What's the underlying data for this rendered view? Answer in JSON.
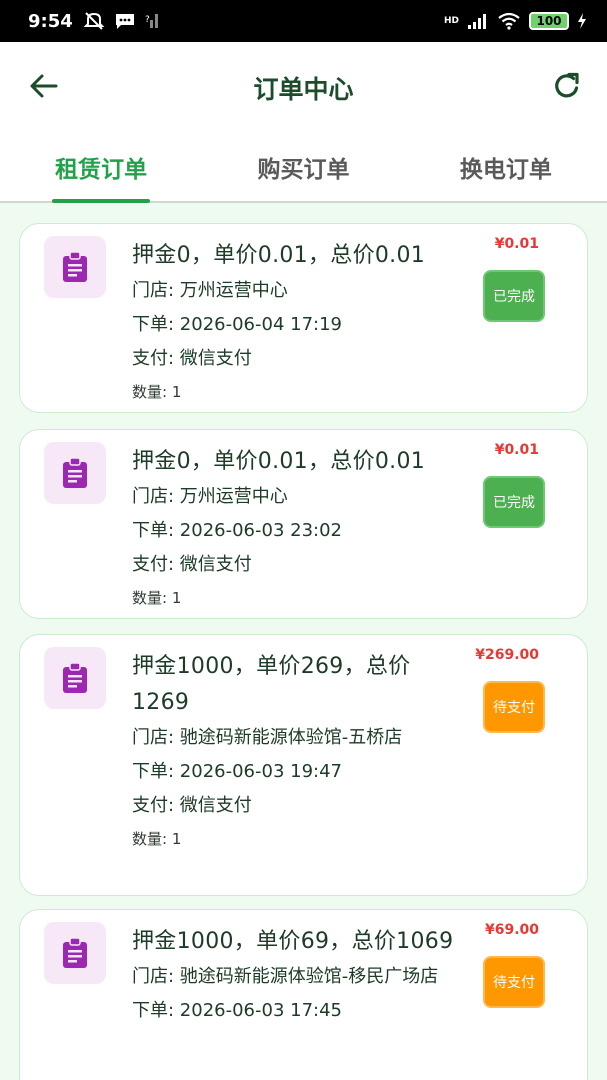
{
  "status_bar": {
    "time": "9:54",
    "icons": [
      "mute-icon",
      "message-icon",
      "no-sim-icon"
    ],
    "network": "HD",
    "battery": "100"
  },
  "header": {
    "title": "订单中心",
    "back_icon": "arrow-left-icon",
    "refresh_icon": "refresh-icon"
  },
  "tabs": [
    {
      "label": "租赁订单",
      "active": true
    },
    {
      "label": "购买订单",
      "active": false
    },
    {
      "label": "换电订单",
      "active": false
    }
  ],
  "colors": {
    "primary_green": "#22a04a",
    "price_red": "#e53935",
    "done_green": "#4caf50",
    "pending_orange": "#ff9800",
    "background": "#effbf0",
    "icon_purple": "#9c27b0"
  },
  "orders": [
    {
      "title": "押金0，单价0.01，总价0.01",
      "store": "门店: 万州运营中心",
      "placed": "下单: 2026-06-04 17:19",
      "payment": "支付: 微信支付",
      "qty": "数量: 1",
      "price": "¥0.01",
      "status": "已完成"
    },
    {
      "title": "押金0，单价0.01，总价0.01",
      "store": "门店: 万州运营中心",
      "placed": "下单: 2026-06-03 23:02",
      "payment": "支付: 微信支付",
      "qty": "数量: 1",
      "price": "¥0.01",
      "status": "已完成"
    },
    {
      "title": "押金1000，单价269，总价1269",
      "store": "门店: 驰途码新能源体验馆-五桥店",
      "placed": "下单: 2026-06-03 19:47",
      "payment": "支付: 微信支付",
      "qty": "数量: 1",
      "price": "¥269.00",
      "status": "待支付"
    },
    {
      "title": "押金1000，单价69，总价1069",
      "store": "门店: 驰途码新能源体验馆-移民广场店",
      "placed": "下单: 2026-06-03 17:45",
      "payment": "",
      "qty": "",
      "price": "¥69.00",
      "status": "待支付"
    }
  ]
}
